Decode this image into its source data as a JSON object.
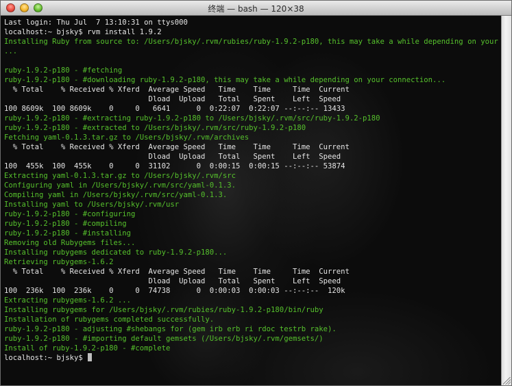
{
  "window": {
    "title": "终端 — bash — 120×38"
  },
  "terminal": {
    "lines": [
      {
        "text": "Last login: Thu Jul  7 13:10:31 on ttys000",
        "color": "white"
      },
      {
        "text": "localhost:~ bjsky$ rvm install 1.9.2",
        "color": "white"
      },
      {
        "text": "Installing Ruby from source to: /Users/bjsky/.rvm/rubies/ruby-1.9.2-p180, this may take a while depending on your cpu(s)",
        "color": "green"
      },
      {
        "text": "...",
        "color": "green"
      },
      {
        "text": "",
        "color": "white"
      },
      {
        "text": "ruby-1.9.2-p180 - #fetching",
        "color": "green"
      },
      {
        "text": "ruby-1.9.2-p180 - #downloading ruby-1.9.2-p180, this may take a while depending on your connection...",
        "color": "green"
      },
      {
        "text": "  % Total    % Received % Xferd  Average Speed   Time    Time     Time  Current",
        "color": "white"
      },
      {
        "text": "                                 Dload  Upload   Total   Spent    Left  Speed",
        "color": "white"
      },
      {
        "text": "100 8609k  100 8609k    0     0   6641      0  0:22:07  0:22:07 --:--:-- 13433",
        "color": "white"
      },
      {
        "text": "ruby-1.9.2-p180 - #extracting ruby-1.9.2-p180 to /Users/bjsky/.rvm/src/ruby-1.9.2-p180",
        "color": "green"
      },
      {
        "text": "ruby-1.9.2-p180 - #extracted to /Users/bjsky/.rvm/src/ruby-1.9.2-p180",
        "color": "green"
      },
      {
        "text": "Fetching yaml-0.1.3.tar.gz to /Users/bjsky/.rvm/archives",
        "color": "green"
      },
      {
        "text": "  % Total    % Received % Xferd  Average Speed   Time    Time     Time  Current",
        "color": "white"
      },
      {
        "text": "                                 Dload  Upload   Total   Spent    Left  Speed",
        "color": "white"
      },
      {
        "text": "100  455k  100  455k    0     0  31102      0  0:00:15  0:00:15 --:--:-- 53874",
        "color": "white"
      },
      {
        "text": "Extracting yaml-0.1.3.tar.gz to /Users/bjsky/.rvm/src",
        "color": "green"
      },
      {
        "text": "Configuring yaml in /Users/bjsky/.rvm/src/yaml-0.1.3.",
        "color": "green"
      },
      {
        "text": "Compiling yaml in /Users/bjsky/.rvm/src/yaml-0.1.3.",
        "color": "green"
      },
      {
        "text": "Installing yaml to /Users/bjsky/.rvm/usr",
        "color": "green"
      },
      {
        "text": "ruby-1.9.2-p180 - #configuring",
        "color": "green"
      },
      {
        "text": "ruby-1.9.2-p180 - #compiling",
        "color": "green"
      },
      {
        "text": "ruby-1.9.2-p180 - #installing",
        "color": "green"
      },
      {
        "text": "Removing old Rubygems files...",
        "color": "green"
      },
      {
        "text": "Installing rubygems dedicated to ruby-1.9.2-p180...",
        "color": "green"
      },
      {
        "text": "Retrieving rubygems-1.6.2",
        "color": "green"
      },
      {
        "text": "  % Total    % Received % Xferd  Average Speed   Time    Time     Time  Current",
        "color": "white"
      },
      {
        "text": "                                 Dload  Upload   Total   Spent    Left  Speed",
        "color": "white"
      },
      {
        "text": "100  236k  100  236k    0     0  74738      0  0:00:03  0:00:03 --:--:--  120k",
        "color": "white"
      },
      {
        "text": "Extracting rubygems-1.6.2 ...",
        "color": "green"
      },
      {
        "text": "Installing rubygems for /Users/bjsky/.rvm/rubies/ruby-1.9.2-p180/bin/ruby",
        "color": "green"
      },
      {
        "text": "Installation of rubygems completed successfully.",
        "color": "green"
      },
      {
        "text": "ruby-1.9.2-p180 - adjusting #shebangs for (gem irb erb ri rdoc testrb rake).",
        "color": "green"
      },
      {
        "text": "ruby-1.9.2-p180 - #importing default gemsets (/Users/bjsky/.rvm/gemsets/)",
        "color": "green"
      },
      {
        "text": "Install of ruby-1.9.2-p180 - #complete",
        "color": "green"
      },
      {
        "text": "localhost:~ bjsky$ ",
        "color": "white",
        "cursor": true
      }
    ]
  },
  "colors": {
    "prompt_text": "#e6e6e6",
    "rvm_output": "#56c12c",
    "background": "#0c0c0c"
  }
}
